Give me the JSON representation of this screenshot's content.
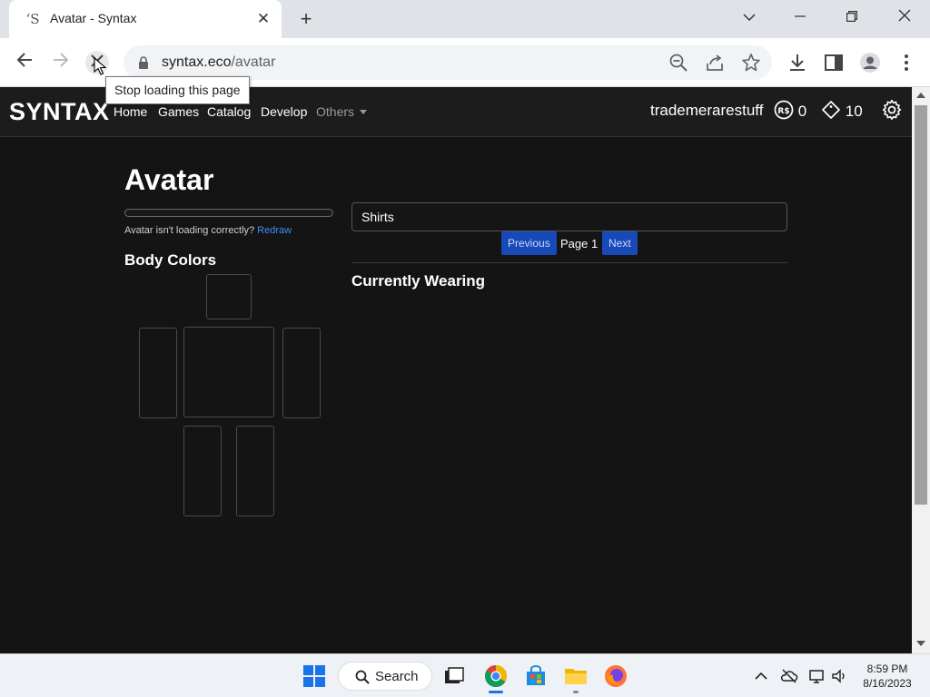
{
  "browser": {
    "tab_title": "Avatar - Syntax",
    "favicon_glyph": "ʻS",
    "url_host": "syntax.eco",
    "url_path": "/avatar",
    "tooltip": "Stop loading this page"
  },
  "site": {
    "brand": "SYNTAX",
    "nav": [
      "Home",
      "Games",
      "Catalog",
      "Develop"
    ],
    "others_label": "Others",
    "username": "trademerarestuff",
    "robux": "0",
    "tix": "10"
  },
  "avatar": {
    "title": "Avatar",
    "load_progress": 0,
    "redraw_note": "Avatar isn't loading correctly?",
    "redraw_link": "Redraw",
    "body_colors_title": "Body Colors",
    "search_value": "Shirts",
    "prev_label": "Previous",
    "page_label": "Page 1",
    "next_label": "Next",
    "wearing_title": "Currently Wearing"
  },
  "taskbar": {
    "search_label": "Search",
    "time": "8:59 PM",
    "date": "8/16/2023"
  },
  "colors": {
    "accent": "#1749b8",
    "link": "#3d8bfd",
    "page_bg": "#141414",
    "navbar_bg": "#1c1c1c"
  }
}
